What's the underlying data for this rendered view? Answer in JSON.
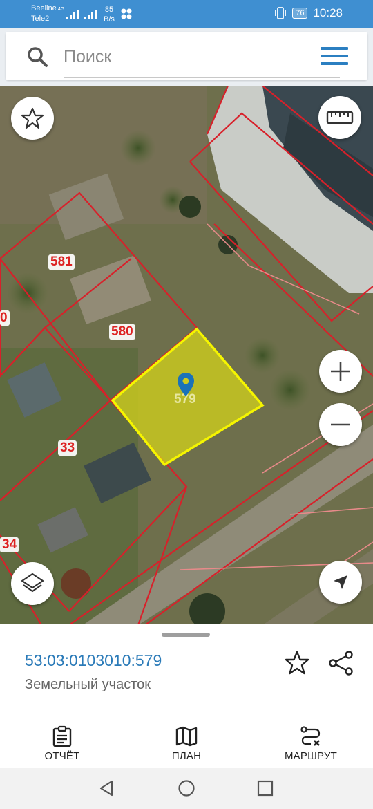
{
  "status_bar": {
    "carrier_1": "Beeline",
    "carrier_2": "Tele2",
    "network_type": "4G",
    "speed_value": "85",
    "speed_unit": "B/s",
    "battery": "76",
    "time": "10:28",
    "icons": [
      "signal-icon",
      "signal-icon",
      "data-dots-icon",
      "vibrate-icon",
      "battery-icon"
    ]
  },
  "search": {
    "placeholder": "Поиск",
    "value": ""
  },
  "map": {
    "parcel_labels": [
      "581",
      "580",
      "579",
      "33",
      "34",
      "0"
    ],
    "selected_parcel": "579",
    "selected_fill": "#cbcb1f",
    "selected_stroke": "#f5f500",
    "boundary_color": "#d8202a",
    "controls": [
      "star-icon",
      "ruler-icon",
      "zoom-in-icon",
      "zoom-out-icon",
      "layers-icon",
      "location-arrow-icon"
    ]
  },
  "sheet": {
    "cadastral_number": "53:03:0103010:579",
    "object_type": "Земельный участок"
  },
  "actions": [
    {
      "label": "ОТЧЁТ",
      "icon": "report-clipboard-icon"
    },
    {
      "label": "ПЛАН",
      "icon": "map-plan-icon"
    },
    {
      "label": "МАРШРУТ",
      "icon": "route-icon"
    }
  ],
  "accent_color": "#2a7ab8"
}
